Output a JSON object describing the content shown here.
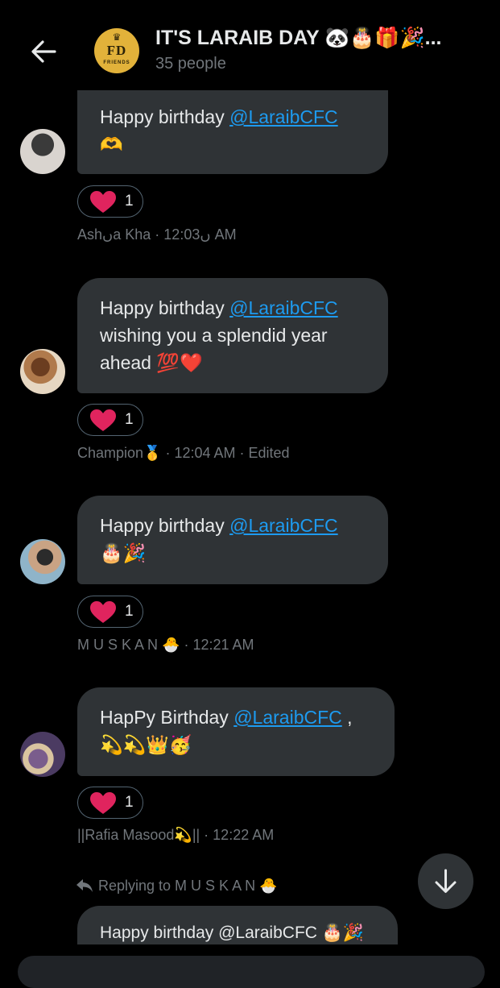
{
  "header": {
    "title": "IT'S LARAIB DAY 🐼🎂🎁🎉...",
    "subtitle": "35 people",
    "avatar_text": "FD",
    "avatar_subtext": "FRIENDS"
  },
  "messages": [
    {
      "text_before": "Happy birthday ",
      "mention": "@LaraibCFC",
      "text_after": " 🫶",
      "reaction_emoji": "heart",
      "reaction_count": "1",
      "meta": "Ashںa Kha · ں12:03 AM"
    },
    {
      "text_before": "Happy birthday ",
      "mention": "@LaraibCFC",
      "text_after": " wishing you a splendid year ahead 💯❤️",
      "reaction_emoji": "heart",
      "reaction_count": "1",
      "meta": "Champion🥇 · 12:04 AM · Edited"
    },
    {
      "text_before": "Happy birthday ",
      "mention": "@LaraibCFC",
      "text_after": " 🎂🎉",
      "reaction_emoji": "heart",
      "reaction_count": "1",
      "meta": "M U S K A N 🐣 · 12:21 AM"
    },
    {
      "text_before": "HapPy Birthday  ",
      "mention": "@LaraibCFC",
      "text_after": " ,💫💫👑🥳",
      "reaction_emoji": "heart",
      "reaction_count": "1",
      "meta": "||Rafia Masood💫|| · 12:22 AM"
    }
  ],
  "reply": {
    "indicator": "Replying to M U S K A N 🐣",
    "last_message_text": "Happy birthday @LaraibCFC 🎂🎉"
  },
  "colors": {
    "background": "#000000",
    "bubble": "#2f3336",
    "mention": "#1d9bf0",
    "muted": "#71767b",
    "heart": "#e0245e"
  }
}
